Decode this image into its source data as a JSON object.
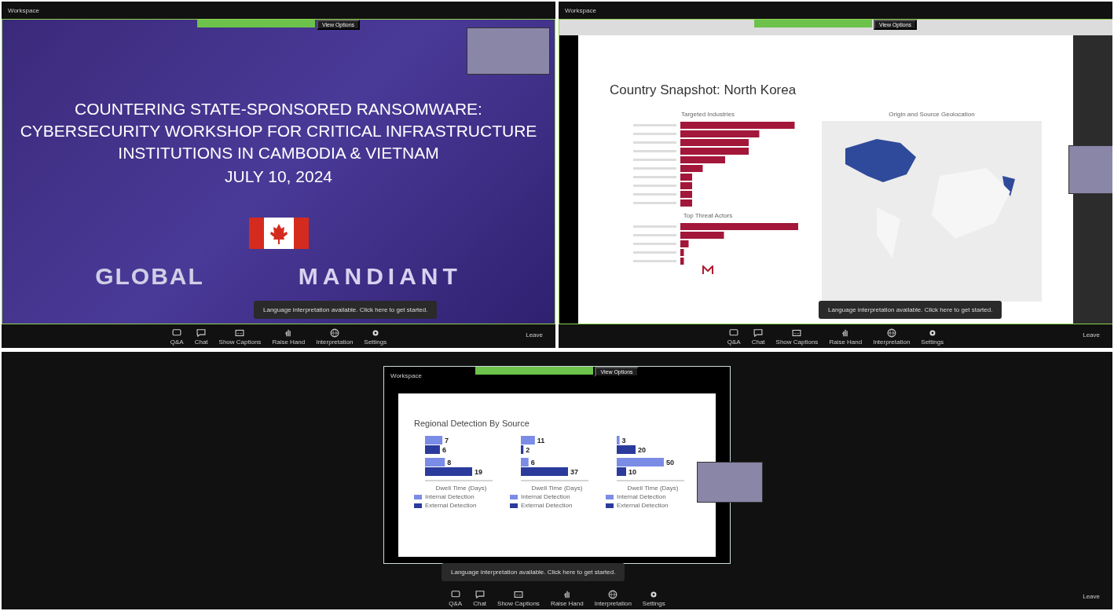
{
  "windows": [
    {
      "kind": "title_slide",
      "app_title": "Workspace",
      "view_options": "View Options",
      "slide": {
        "title_lines": [
          "COUNTERING STATE-SPONSORED RANSOMWARE:",
          "CYBERSECURITY WORKSHOP FOR CRITICAL INFRASTRUCTURE",
          "INSTITUTIONS IN CAMBODIA & VIETNAM"
        ],
        "date": "JULY 10, 2024",
        "logo_left": "GLOBAL",
        "logo_right": "MANDIANT"
      },
      "notice": "Language interpretation available. Click here to get started.",
      "toolbar": [
        "Q&A",
        "Chat",
        "Show Captions",
        "Raise Hand",
        "Interpretation",
        "Settings"
      ],
      "leave": "Leave"
    },
    {
      "kind": "snapshot_slide",
      "app_title": "Workspace",
      "view_options": "View Options",
      "slide": {
        "title": "Country Snapshot: North Korea",
        "industries_title": "Targeted Industries",
        "actors_title": "Top Threat Actors",
        "map_title": "Origin and Source Geolocation"
      },
      "notice": "Language interpretation available. Click here to get started.",
      "toolbar": [
        "Q&A",
        "Chat",
        "Show Captions",
        "Raise Hand",
        "Interpretation",
        "Settings"
      ],
      "leave": "Leave"
    },
    {
      "kind": "detection_slide",
      "app_title": "Workspace",
      "view_options": "View Options",
      "slide": {
        "title": "Regional Detection By Source",
        "charts": [
          {
            "chart_data": {
              "type": "bar",
              "orientation": "horizontal",
              "legend": "bottom",
              "xlabel": "Dwell Time (Days)",
              "data_labels": true,
              "series": [
                {
                  "name": "Internal Detection",
                  "color": "#7b8ce6",
                  "values": [
                    7,
                    8
                  ]
                },
                {
                  "name": "External Detection",
                  "color": "#2a3b9c",
                  "values": [
                    6,
                    19
                  ]
                }
              ]
            }
          },
          {
            "chart_data": {
              "type": "bar",
              "orientation": "horizontal",
              "legend": "bottom",
              "xlabel": "Dwell Time (Days)",
              "data_labels": true,
              "series": [
                {
                  "name": "Internal Detection",
                  "color": "#7b8ce6",
                  "values": [
                    11,
                    6
                  ]
                },
                {
                  "name": "External Detection",
                  "color": "#2a3b9c",
                  "values": [
                    2,
                    37
                  ]
                }
              ]
            }
          },
          {
            "chart_data": {
              "type": "bar",
              "orientation": "horizontal",
              "legend": "bottom",
              "xlabel": "Dwell Time (Days)",
              "data_labels": true,
              "series": [
                {
                  "name": "Internal Detection",
                  "color": "#7b8ce6",
                  "values": [
                    3,
                    50
                  ]
                },
                {
                  "name": "External Detection",
                  "color": "#2a3b9c",
                  "values": [
                    20,
                    10
                  ]
                }
              ]
            }
          }
        ]
      },
      "notice": "Language interpretation available. Click here to get started.",
      "toolbar": [
        "Q&A",
        "Chat",
        "Show Captions",
        "Raise Hand",
        "Interpretation",
        "Settings"
      ],
      "leave": "Leave"
    }
  ]
}
